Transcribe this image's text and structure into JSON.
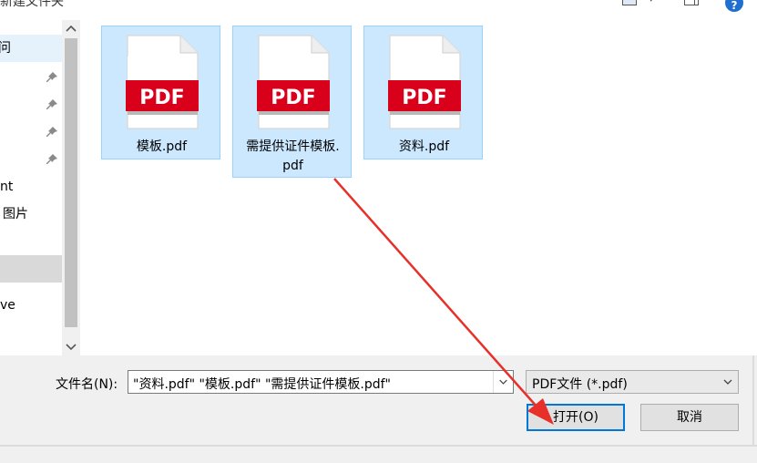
{
  "toolbar": {
    "new_folder_label": "新建文件夹",
    "icons": [
      "view-icon",
      "chevron-down-icon",
      "preview-pane-icon",
      "help-icon"
    ],
    "help_glyph": "?"
  },
  "nav": {
    "items": [
      {
        "text": "问",
        "pinned": false,
        "state": "selected"
      },
      {
        "text": "",
        "pinned": true,
        "state": ""
      },
      {
        "text": "",
        "pinned": true,
        "state": ""
      },
      {
        "text": "",
        "pinned": true,
        "state": ""
      },
      {
        "text": "",
        "pinned": true,
        "state": ""
      },
      {
        "text": "nt",
        "pinned": false,
        "state": ""
      },
      {
        "text": "图片",
        "pinned": false,
        "state": ""
      },
      {
        "text": "",
        "pinned": false,
        "state": ""
      },
      {
        "text": "",
        "pinned": false,
        "state": "highlight"
      },
      {
        "text": "ve",
        "pinned": false,
        "state": ""
      }
    ],
    "scroll_up_glyph": "⌃",
    "scroll_down_glyph": "⌄"
  },
  "files": [
    {
      "name": "模板.pdf",
      "badge": "PDF",
      "selected": true
    },
    {
      "name": "需提供证件模板.pdf",
      "name_lines": [
        "需提供证件模板.",
        "pdf"
      ],
      "badge": "PDF",
      "selected": true
    },
    {
      "name": "资料.pdf",
      "badge": "PDF",
      "selected": true
    }
  ],
  "bottom": {
    "filename_label": "文件名(N):",
    "filename_value": "\"资料.pdf\" \"模板.pdf\" \"需提供证件模板.pdf\"",
    "filetype_value": "PDF文件 (*.pdf)",
    "open_button": "打开(O)",
    "cancel_button": "取消"
  },
  "colors": {
    "selection_fill": "#cce8ff",
    "selection_border": "#99d1ff",
    "pdf_red": "#d9001b",
    "accent": "#0078d7",
    "annotation_arrow": "#e8302a"
  }
}
